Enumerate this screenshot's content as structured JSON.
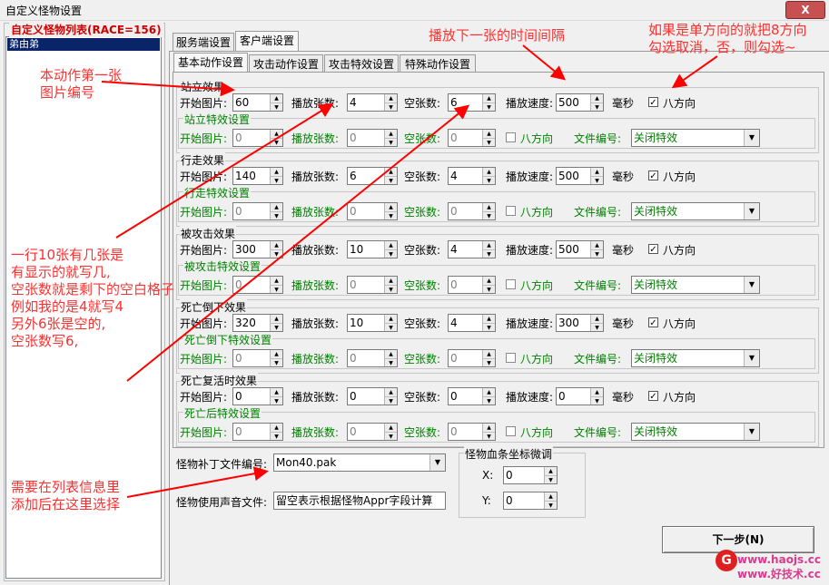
{
  "window": {
    "title": "自定义怪物设置",
    "close_label": "X"
  },
  "monster_list": {
    "title": "自定义怪物列表(RACE=156)",
    "items": [
      "弟由弟"
    ]
  },
  "tabs_top": [
    {
      "label": "服务端设置"
    },
    {
      "label": "客户端设置"
    }
  ],
  "tabs_sub": [
    {
      "label": "基本动作设置"
    },
    {
      "label": "攻击动作设置"
    },
    {
      "label": "攻击特效设置"
    },
    {
      "label": "特殊动作设置"
    }
  ],
  "labels": {
    "start_image": "开始图片:",
    "play_count": "播放张数:",
    "empty_count": "空张数:",
    "play_speed": "播放速度:",
    "ms": "毫秒",
    "eight_dir": "八方向",
    "file_no": "文件编号:",
    "fx_start_image": "开始图片:",
    "fx_play_count": "播放张数:",
    "fx_empty_count": "空张数:"
  },
  "sections": [
    {
      "title": "站立效果",
      "start": "60",
      "count": "4",
      "empty": "6",
      "speed": "500",
      "eight": true,
      "fx_title": "站立特效设置",
      "fx_start": "0",
      "fx_count": "0",
      "fx_empty": "0",
      "fx_file": "关闭特效"
    },
    {
      "title": "行走效果",
      "start": "140",
      "count": "6",
      "empty": "4",
      "speed": "500",
      "eight": true,
      "fx_title": "行走特效设置",
      "fx_start": "0",
      "fx_count": "0",
      "fx_empty": "0",
      "fx_file": "关闭特效"
    },
    {
      "title": "被攻击效果",
      "start": "300",
      "count": "10",
      "empty": "4",
      "speed": "500",
      "eight": true,
      "fx_title": "被攻击特效设置",
      "fx_start": "0",
      "fx_count": "0",
      "fx_empty": "0",
      "fx_file": "关闭特效"
    },
    {
      "title": "死亡倒下效果",
      "start": "320",
      "count": "10",
      "empty": "4",
      "speed": "300",
      "eight": true,
      "fx_title": "死亡倒下特效设置",
      "fx_start": "0",
      "fx_count": "0",
      "fx_empty": "0",
      "fx_file": "关闭特效"
    },
    {
      "title": "死亡复活时效果",
      "start": "0",
      "count": "0",
      "empty": "0",
      "speed": "0",
      "eight": true,
      "fx_title": "死亡后特效设置",
      "fx_start": "0",
      "fx_count": "0",
      "fx_empty": "0",
      "fx_file": "关闭特效"
    }
  ],
  "bottom": {
    "patch_label": "怪物补丁文件编号:",
    "patch_value": "Mon40.pak",
    "sound_label": "怪物使用声音文件:",
    "sound_value": "留空表示根据怪物Appr字段计算",
    "hp_group_title": "怪物血条坐标微调",
    "x_label": "X:",
    "x_value": "0",
    "y_label": "Y:",
    "y_value": "0",
    "next_button": "下一步(N)"
  },
  "annotations": {
    "first_image": [
      "本动作第一张",
      "图片编号"
    ],
    "interval": "播放下一张的时间间隔",
    "direction": [
      "如果是单方向的就把8方向",
      "勾选取消，否，则勾选~"
    ],
    "rows": [
      "一行10张有几张是",
      "有显示的就写几,",
      "空张数就是剩下的空白格子",
      "例如我的是4就写4",
      "另外6张是空的,",
      "空张数写6,"
    ],
    "list_info": [
      "需要在列表信息里",
      "添加后在这里选择"
    ]
  },
  "watermark": {
    "line1": "www.haojs.cc",
    "line2": "www.好技术.cc"
  },
  "colors": {
    "annotation": "#ff3030",
    "arrow": "#ff0000",
    "group_label_green": "#008000",
    "list_title": "#d00000",
    "selection": "#0a246a"
  }
}
